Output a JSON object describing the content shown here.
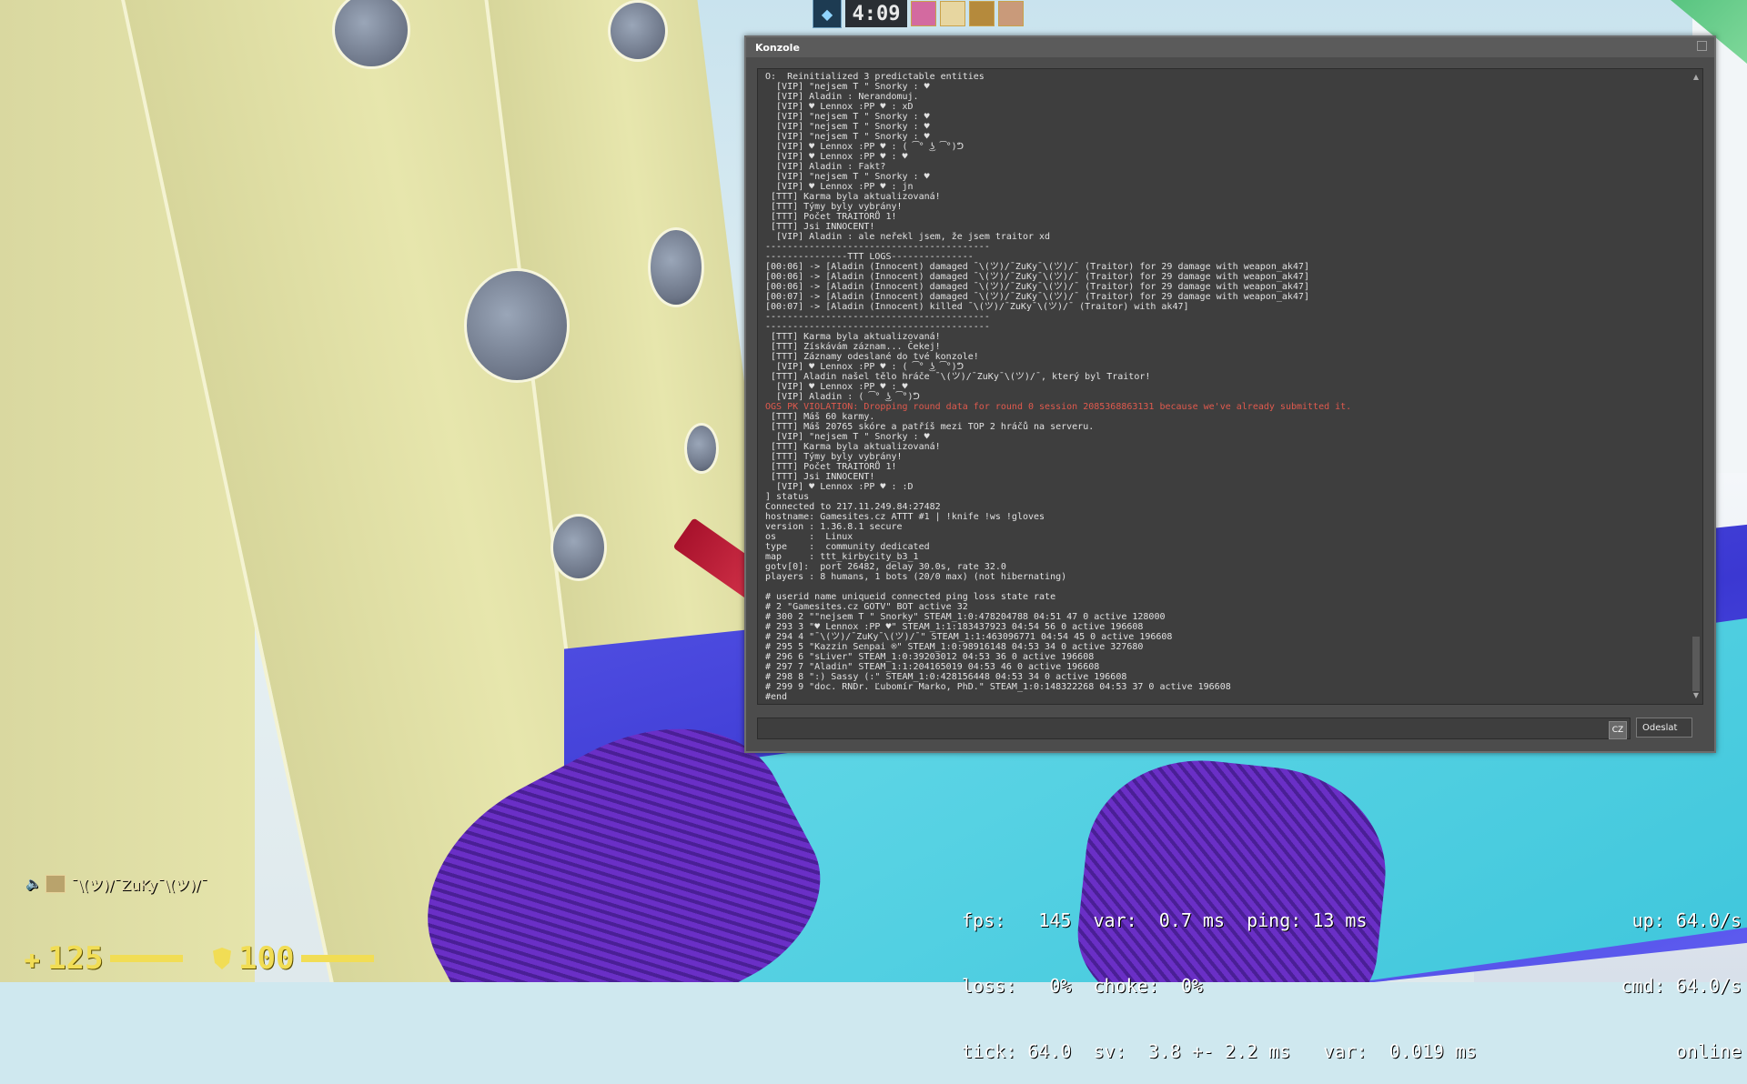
{
  "hud_top": {
    "timer": "4:09"
  },
  "console": {
    "title": "Konzole",
    "lang_indicator": "CZ",
    "send_label": "Odeslat",
    "lines": [
      {
        "t": "O:  Reinitialized 3 predictable entities"
      },
      {
        "t": "  [VIP] \"nejsem T \" Snorky : ♥"
      },
      {
        "t": "  [VIP] Aladin : Nerandomuj."
      },
      {
        "t": "  [VIP] ♥ Lennox :PP ♥ : xD"
      },
      {
        "t": "  [VIP] \"nejsem T \" Snorky : ♥"
      },
      {
        "t": "  [VIP] \"nejsem T \" Snorky : ♥"
      },
      {
        "t": "  [VIP] \"nejsem T \" Snorky : ♥"
      },
      {
        "t": "  [VIP] ♥ Lennox :PP ♥ : ( ͡° ͜ʖ ͡°)ᕤ"
      },
      {
        "t": "  [VIP] ♥ Lennox :PP ♥ : ♥"
      },
      {
        "t": "  [VIP] Aladin : Fakt?"
      },
      {
        "t": "  [VIP] \"nejsem T \" Snorky : ♥"
      },
      {
        "t": "  [VIP] ♥ Lennox :PP ♥ : jn"
      },
      {
        "t": " [TTT] Karma byla aktualizovaná!"
      },
      {
        "t": " [TTT] Týmy byly vybrány!"
      },
      {
        "t": " [TTT] Počet TRAITORŮ 1!"
      },
      {
        "t": " [TTT] Jsi INNOCENT!"
      },
      {
        "t": "  [VIP] Aladin : ale neřekl jsem, že jsem traitor xd"
      },
      {
        "t": "-----------------------------------------"
      },
      {
        "t": "---------------TTT LOGS---------------"
      },
      {
        "t": "[00:06] -> [Aladin (Innocent) damaged ¯\\(ツ)/¯ZuKy¯\\(ツ)/¯ (Traitor) for 29 damage with weapon_ak47]"
      },
      {
        "t": "[00:06] -> [Aladin (Innocent) damaged ¯\\(ツ)/¯ZuKy¯\\(ツ)/¯ (Traitor) for 29 damage with weapon_ak47]"
      },
      {
        "t": "[00:06] -> [Aladin (Innocent) damaged ¯\\(ツ)/¯ZuKy¯\\(ツ)/¯ (Traitor) for 29 damage with weapon_ak47]"
      },
      {
        "t": "[00:07] -> [Aladin (Innocent) damaged ¯\\(ツ)/¯ZuKy¯\\(ツ)/¯ (Traitor) for 29 damage with weapon_ak47]"
      },
      {
        "t": "[00:07] -> [Aladin (Innocent) killed ¯\\(ツ)/¯ZuKy¯\\(ツ)/¯ (Traitor) with ak47]"
      },
      {
        "t": "-----------------------------------------"
      },
      {
        "t": "-----------------------------------------"
      },
      {
        "t": " [TTT] Karma byla aktualizovaná!"
      },
      {
        "t": " [TTT] Získávám záznam... Čekej!"
      },
      {
        "t": " [TTT] Záznamy odeslané do tvé konzole!"
      },
      {
        "t": "  [VIP] ♥ Lennox :PP ♥ : ( ͡° ͜ʖ ͡°)ᕤ"
      },
      {
        "t": " [TTT] Aladin našel tělo hráče ¯\\(ツ)/¯ZuKy¯\\(ツ)/¯, který byl Traitor!"
      },
      {
        "t": "  [VIP] ♥ Lennox :PP ♥ : ♥"
      },
      {
        "t": "  [VIP] Aladin : ( ͡° ͜ʖ ͡°)ᕤ"
      },
      {
        "t": "OGS PK VIOLATION: Dropping round data for round 0 session 2085368863131 because we've already submitted it.",
        "err": true
      },
      {
        "t": " [TTT] Máš 60 karmy."
      },
      {
        "t": " [TTT] Máš 20765 skóre a patříš mezi TOP 2 hráčů na serveru."
      },
      {
        "t": "  [VIP] \"nejsem T \" Snorky : ♥"
      },
      {
        "t": " [TTT] Karma byla aktualizovaná!"
      },
      {
        "t": " [TTT] Týmy byly vybrány!"
      },
      {
        "t": " [TTT] Počet TRAITORŮ 1!"
      },
      {
        "t": " [TTT] Jsi INNOCENT!"
      },
      {
        "t": "  [VIP] ♥ Lennox :PP ♥ : :D"
      },
      {
        "t": "] status"
      },
      {
        "t": "Connected to 217.11.249.84:27482"
      },
      {
        "t": "hostname: Gamesites.cz ATTT #1 | !knife !ws !gloves"
      },
      {
        "t": "version : 1.36.8.1 secure"
      },
      {
        "t": "os      :  Linux"
      },
      {
        "t": "type    :  community dedicated"
      },
      {
        "t": "map     : ttt_kirbycity_b3_1"
      },
      {
        "t": "gotv[0]:  port 26482, delay 30.0s, rate 32.0"
      },
      {
        "t": "players : 8 humans, 1 bots (20/0 max) (not hibernating)"
      },
      {
        "t": ""
      },
      {
        "t": "# userid name uniqueid connected ping loss state rate"
      },
      {
        "t": "# 2 \"Gamesites.cz GOTV\" BOT active 32"
      },
      {
        "t": "# 300 2 \"\"nejsem T \" Snorky\" STEAM_1:0:478204788 04:51 47 0 active 128000"
      },
      {
        "t": "# 293 3 \"♥ Lennox :PP ♥\" STEAM_1:1:183437923 04:54 56 0 active 196608"
      },
      {
        "t": "# 294 4 \"¯\\(ツ)/¯ZuKy¯\\(ツ)/¯\" STEAM_1:1:463096771 04:54 45 0 active 196608"
      },
      {
        "t": "# 295 5 \"Kazzin Senpai ®\" STEAM_1:0:98916148 04:53 34 0 active 327680"
      },
      {
        "t": "# 296 6 \"sLiver\" STEAM_1:0:39203012 04:53 36 0 active 196608"
      },
      {
        "t": "# 297 7 \"Aladin\" STEAM_1:1:204165019 04:53 46 0 active 196608"
      },
      {
        "t": "# 298 8 \":) Sassy (:\" STEAM_1:0:428156448 04:53 34 0 active 196608"
      },
      {
        "t": "# 299 9 \"doc. RNDr. Ľubomír Marko, PhD.\" STEAM_1:0:148322268 04:53 37 0 active 196608"
      },
      {
        "t": "#end"
      }
    ]
  },
  "netgraph": {
    "left_lines": [
      "fps:   145  var:  0.7 ms  ping: 13 ms",
      "loss:   0%  choke:  0%",
      "tick: 64.0  sv:  3.8 +- 2.2 ms   var:  0.019 ms"
    ],
    "right_lines": [
      "up: 64.0/s",
      "cmd: 64.0/s",
      "online"
    ]
  },
  "hud_bottom": {
    "voice_player": "¯\\(ツ)/¯ZuKy¯\\(ツ)/¯",
    "health": "125",
    "armor": "100"
  },
  "colors": {
    "hud_yellow": "#f1dd55",
    "console_bg": "#3e3e3e",
    "error_text": "#e05a4e"
  }
}
